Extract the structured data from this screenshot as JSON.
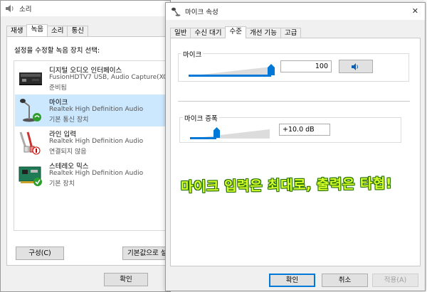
{
  "sound_window": {
    "title": "소리",
    "tabs": [
      "재생",
      "녹음",
      "소리",
      "통신"
    ],
    "instruction": "설정을 수정할 녹음 장치 선택:",
    "devices": [
      {
        "name": "디지털 오디오 인터페이스",
        "desc": "FusionHDTV7 USB, Audio Capture(XC",
        "status": "준비됨"
      },
      {
        "name": "마이크",
        "desc": "Realtek High Definition Audio",
        "status": "기본 통신 장치"
      },
      {
        "name": "라인 입력",
        "desc": "Realtek High Definition Audio",
        "status": "연결되지 않음"
      },
      {
        "name": "스테레오 믹스",
        "desc": "Realtek High Definition Audio",
        "status": "기본 장치"
      }
    ],
    "configure_btn": "구성(C)",
    "default_btn": "기본값으로 설",
    "ok_btn": "확인"
  },
  "mic_window": {
    "title": "마이크 속성",
    "tabs": [
      "일반",
      "수신 대기",
      "수준",
      "개선 기능",
      "고급"
    ],
    "active_tab": "수준",
    "mic_group_label": "마이크",
    "mic_level": 100,
    "boost_group_label": "마이크 증폭",
    "boost_value": "+10.0 dB",
    "boost_level": 0.33,
    "ok_btn": "확인",
    "cancel_btn": "취소",
    "apply_btn": "적용(A)",
    "close_glyph": "✕"
  },
  "overlay_text": "마이크 입력은 최대로, 출력은 타협!",
  "colors": {
    "accent": "#0078d7",
    "selection": "#cce8ff",
    "overlay": "#d6ff2a"
  }
}
